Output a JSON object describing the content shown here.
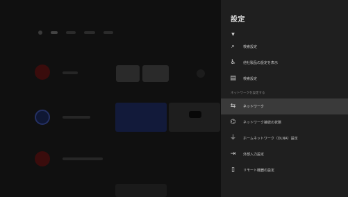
{
  "panel": {
    "title": "設定",
    "items": [
      {
        "icon": "partial-icon",
        "glyph": "▾",
        "label": "",
        "type": "item"
      },
      {
        "icon": "search-icon",
        "glyph": "⌕",
        "label": "検索設定",
        "type": "item"
      },
      {
        "icon": "accessibility-icon",
        "glyph": "♿",
        "label": "他社製品の設定を表示",
        "type": "item"
      },
      {
        "icon": "document-icon",
        "glyph": "▤",
        "label": "検索設定",
        "type": "item"
      },
      {
        "label": "ネットワークを設定する",
        "type": "section"
      },
      {
        "icon": "network-icon",
        "glyph": "⇆",
        "label": "ネットワーク",
        "type": "item",
        "selected": true
      },
      {
        "icon": "wifi-settings-icon",
        "glyph": "⌬",
        "label": "ネットワーク接続の状態",
        "type": "item"
      },
      {
        "icon": "home-network-icon",
        "glyph": "⏚",
        "label": "ホームネットワーク（DLNA）設定",
        "type": "item"
      },
      {
        "icon": "input-icon",
        "glyph": "⇥",
        "label": "外部入力設定",
        "type": "item"
      },
      {
        "icon": "device-icon",
        "glyph": "▯",
        "label": "リモート機器の設定",
        "type": "item"
      }
    ]
  },
  "colors": {
    "panel_bg": "#1f1f1f",
    "selected_bg": "#3a3a3a",
    "background": "#101010"
  }
}
